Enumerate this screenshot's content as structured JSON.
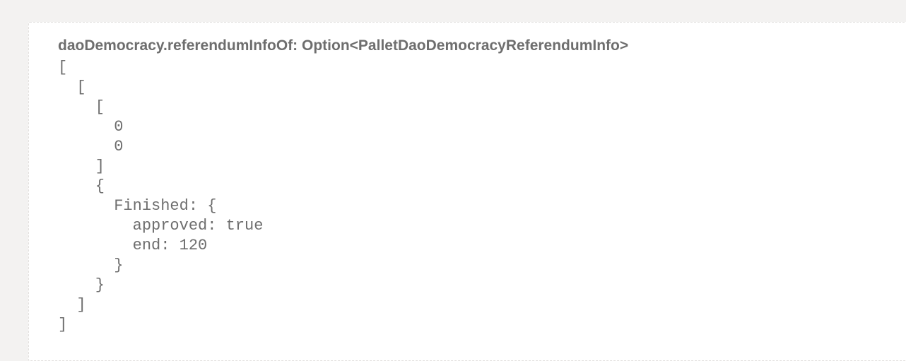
{
  "query": {
    "label": "daoDemocracy.referendumInfoOf: Option<PalletDaoDemocracyReferendumInfo>"
  },
  "result": {
    "lines": [
      "[",
      "  [",
      "    [",
      "      0",
      "      0",
      "    ]",
      "    {",
      "      Finished: {",
      "        approved: true",
      "        end: 120",
      "      }",
      "    }",
      "  ]",
      "]"
    ]
  }
}
